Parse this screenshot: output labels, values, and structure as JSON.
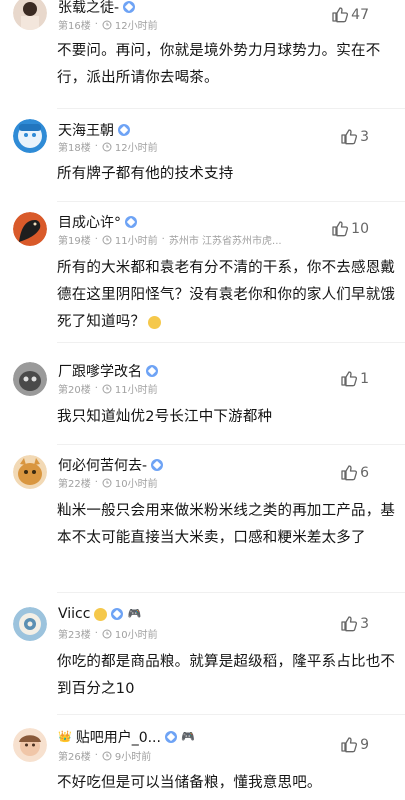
{
  "posts": [
    {
      "username": "张载之徒-",
      "floor": "第16楼",
      "time": "12小时前",
      "location": "",
      "likes": "47",
      "text": "不要问。再问，你就是境外势力月球势力。实在不行，派出所请你去喝茶。",
      "avatar_color": "#d9c2b2"
    },
    {
      "username": "天海王朝",
      "floor": "第18楼",
      "time": "12小时前",
      "location": "",
      "likes": "3",
      "text": "所有牌子都有他的技术支持",
      "avatar_color": "#2f8bd6"
    },
    {
      "username": "目成心许°",
      "floor": "第19楼",
      "time": "11小时前",
      "location": "苏州市 江苏省苏州市虎...",
      "likes": "10",
      "text": "所有的大米都和袁老有分不清的干系，你不去感恩戴德在这里阴阳怪气？没有袁老你和你的家人们早就饿死了知道吗？",
      "avatar_color": "#2a2a2a"
    },
    {
      "username": "厂跟嗲学改名",
      "floor": "第20楼",
      "time": "11小时前",
      "location": "",
      "likes": "1",
      "text": "我只知道灿优2号长江中下游都种",
      "avatar_color": "#6f6f6f"
    },
    {
      "username": "何必何苦何去-",
      "floor": "第22楼",
      "time": "10小时前",
      "location": "",
      "likes": "6",
      "text": "籼米一般只会用来做米粉米线之类的再加工产品，基本不太可能直接当大米卖，口感和粳米差太多了",
      "avatar_color": "#e0b07a"
    },
    {
      "username": "Viicc",
      "floor": "第23楼",
      "time": "10小时前",
      "location": "",
      "likes": "3",
      "text": "你吃的都是商品粮。就算是超级稻，隆平系占比也不到百分之10",
      "avatar_color": "#5a8fb3"
    },
    {
      "username": "贴吧用户_0...",
      "floor": "第26楼",
      "time": "9小时前",
      "location": "",
      "likes": "9",
      "text": "不好吃但是可以当储备粮，懂我意思吧。",
      "avatar_color": "#f0c6a8"
    }
  ],
  "ui": {
    "like_color": "#666666",
    "meta_color": "#a0a0a0",
    "badge_color": "#6ea3f5"
  }
}
